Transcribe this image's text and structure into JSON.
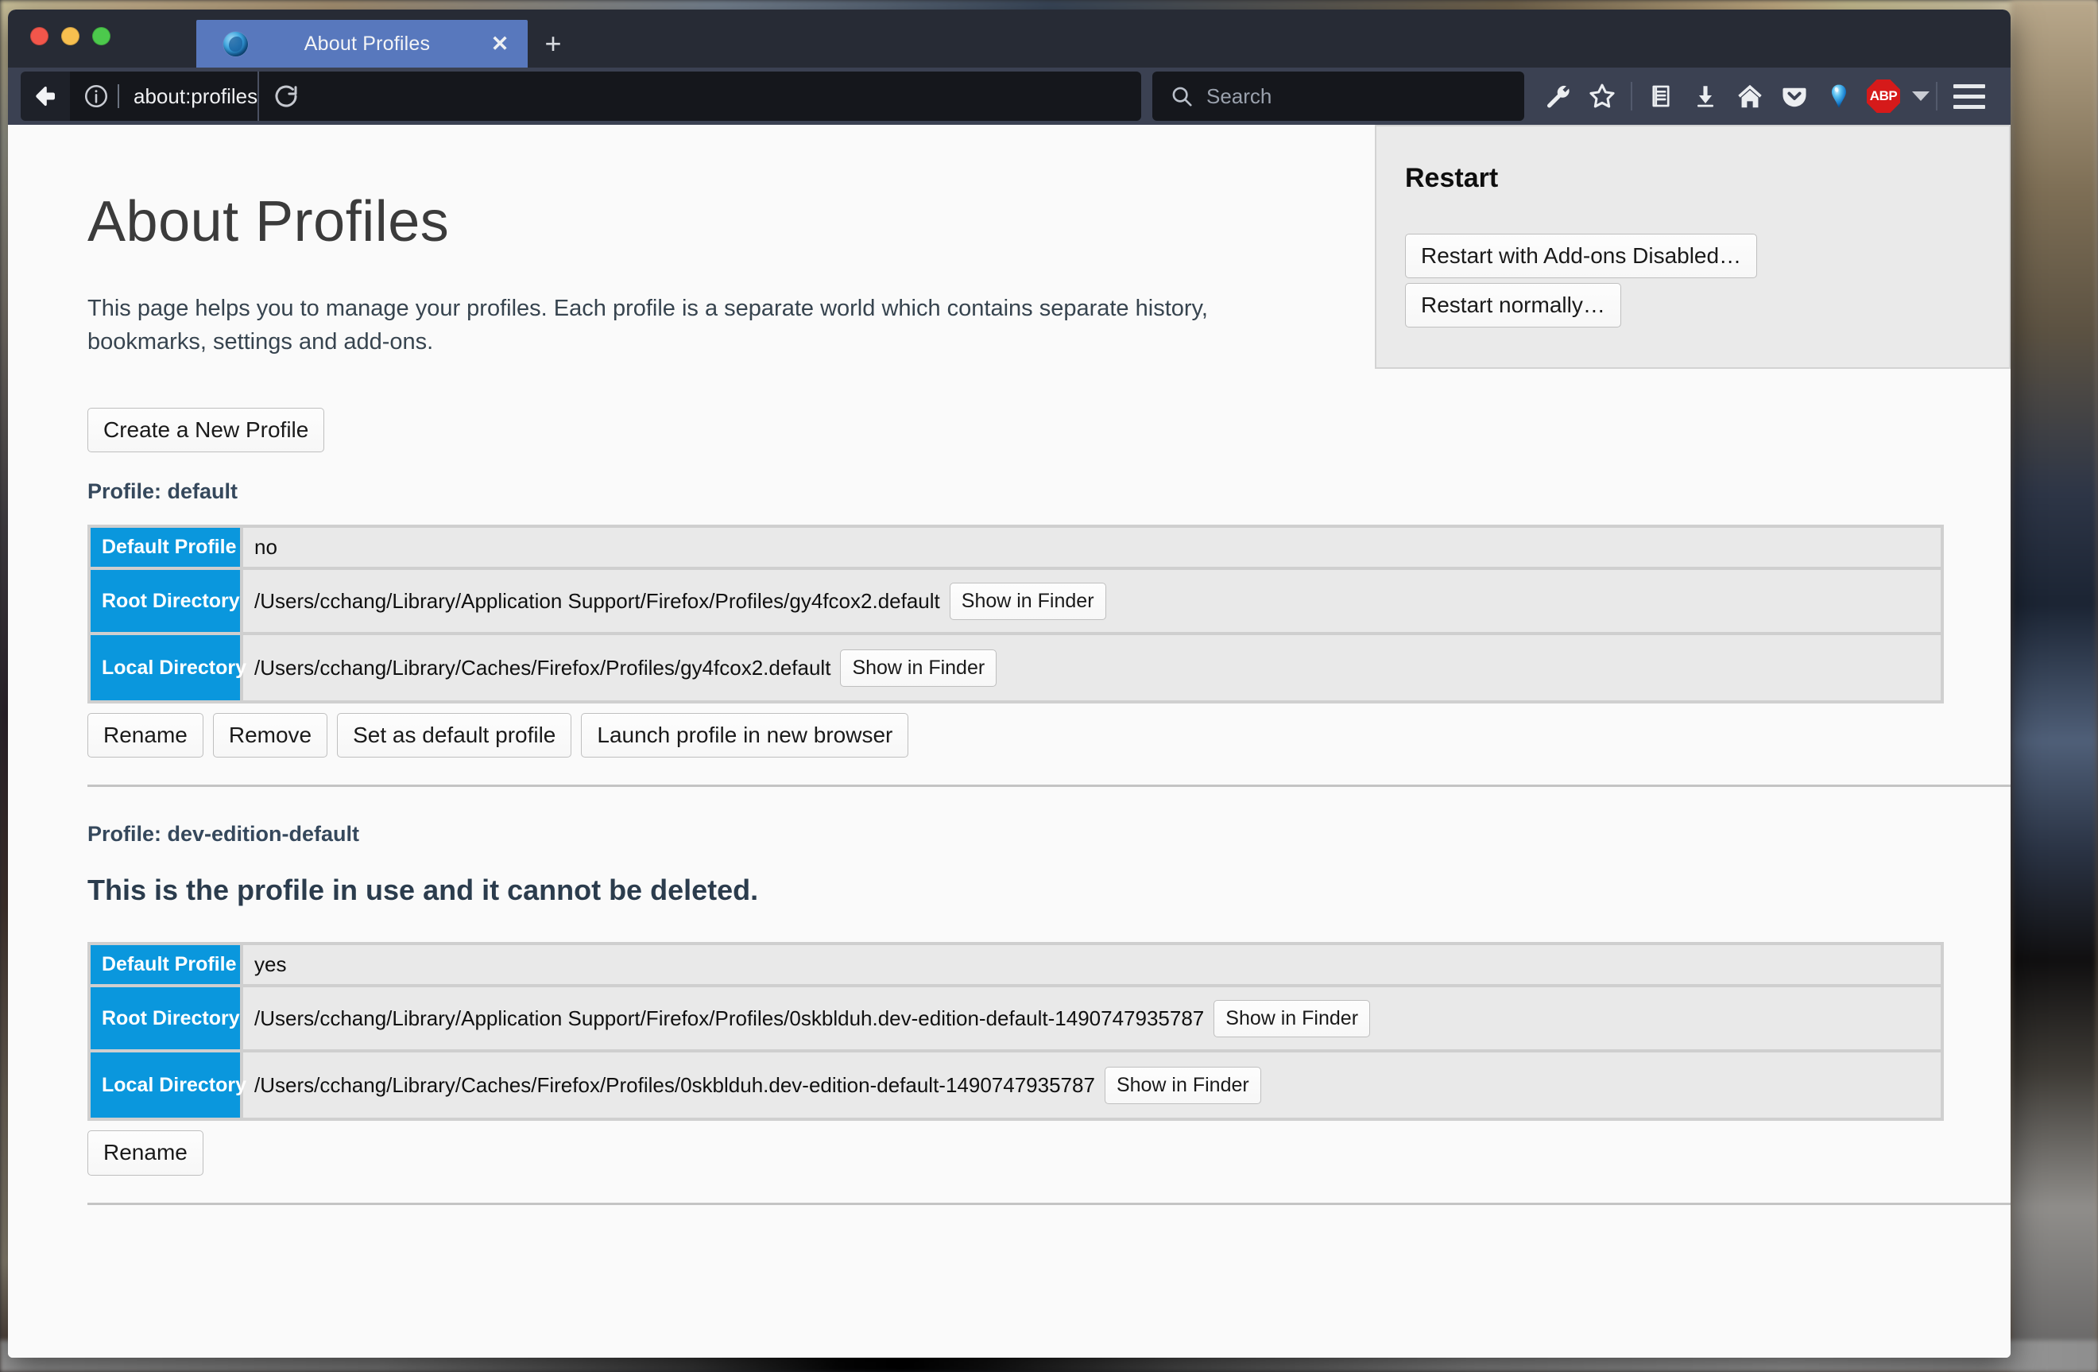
{
  "window": {
    "traffic_lights": [
      "close",
      "minimize",
      "zoom"
    ]
  },
  "tabs": [
    {
      "title": "About Profiles",
      "favicon": "firefox-developer-edition-icon",
      "active": true,
      "close_label": "✕"
    }
  ],
  "newtab_label": "+",
  "navigation": {
    "back_icon": "back-arrow-icon",
    "identity_icon": "info-circle-icon",
    "url": "about:profiles",
    "reload_icon": "reload-icon"
  },
  "search": {
    "placeholder": "Search",
    "icon": "search-icon"
  },
  "toolbar_icons": [
    {
      "name": "wrench-icon",
      "label": "Developer Tools"
    },
    {
      "name": "star-icon",
      "label": "Bookmark this page"
    },
    {
      "name": "library-icon",
      "label": "Library"
    },
    {
      "name": "download-icon",
      "label": "Downloads"
    },
    {
      "name": "home-icon",
      "label": "Home"
    },
    {
      "name": "pocket-icon",
      "label": "Save to Pocket"
    },
    {
      "name": "balloon-icon",
      "label": "Extension"
    },
    {
      "name": "abp-icon",
      "label": "ABP"
    }
  ],
  "abp": {
    "text": "ABP"
  },
  "menu_icon": "hamburger-menu-icon",
  "page": {
    "title": "About Profiles",
    "description": "This page helps you to manage your profiles. Each profile is a separate world which contains separate history, bookmarks, settings and add-ons.",
    "create_profile_label": "Create a New Profile"
  },
  "restart_panel": {
    "heading": "Restart",
    "buttons": [
      {
        "label": "Restart with Add-ons Disabled…"
      },
      {
        "label": "Restart normally…"
      }
    ]
  },
  "labels": {
    "default_profile": "Default Profile",
    "root_directory": "Root Directory",
    "local_directory": "Local Directory",
    "show_in_finder": "Show in Finder"
  },
  "profiles": [
    {
      "heading": "Profile: default",
      "in_use_notice": null,
      "default_profile": "no",
      "root_directory": "/Users/cchang/Library/Application Support/Firefox/Profiles/gy4fcox2.default",
      "local_directory": "/Users/cchang/Library/Caches/Firefox/Profiles/gy4fcox2.default",
      "actions": [
        {
          "label": "Rename"
        },
        {
          "label": "Remove"
        },
        {
          "label": "Set as default profile"
        },
        {
          "label": "Launch profile in new browser"
        }
      ]
    },
    {
      "heading": "Profile: dev-edition-default",
      "in_use_notice": "This is the profile in use and it cannot be deleted.",
      "default_profile": "yes",
      "root_directory": "/Users/cchang/Library/Application Support/Firefox/Profiles/0skblduh.dev-edition-default-1490747935787",
      "local_directory": "/Users/cchang/Library/Caches/Firefox/Profiles/0skblduh.dev-edition-default-1490747935787",
      "actions": [
        {
          "label": "Rename"
        }
      ]
    }
  ],
  "colors": {
    "tab_active": "#5878bd",
    "chrome_dark": "#272b35",
    "navbar": "#3b4152",
    "urlbar": "#15171c",
    "table_header_blue": "#0a97dd",
    "table_cell": "#e9e9e9",
    "panel_bg": "#eaeaea",
    "abp_red": "#d61a1a"
  }
}
